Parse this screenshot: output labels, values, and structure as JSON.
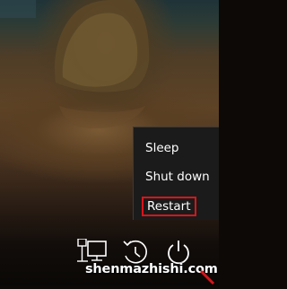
{
  "power_menu": {
    "items": [
      {
        "label": "Sleep"
      },
      {
        "label": "Shut down"
      },
      {
        "label": "Restart",
        "highlighted": true
      }
    ],
    "highlight_color": "#d8141b"
  },
  "bottom_icons": [
    {
      "icon": "network-icon"
    },
    {
      "icon": "ease-of-access-icon"
    },
    {
      "icon": "power-icon"
    }
  ],
  "watermark": {
    "text": "shenmazhishi.com"
  }
}
